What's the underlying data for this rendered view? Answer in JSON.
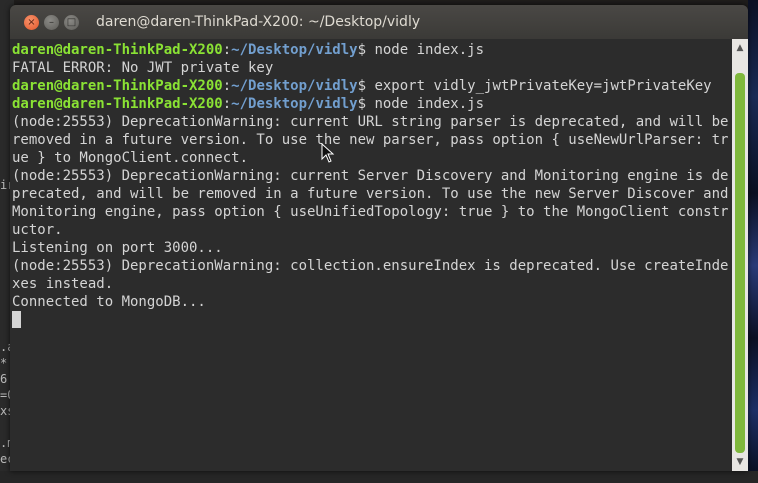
{
  "background": {
    "left_fragments": [
      "ir",
      ".a",
      "*",
      "6:",
      "=0",
      "xs",
      ".m",
      "ec"
    ]
  },
  "window": {
    "title": "daren@daren-ThinkPad-X200: ~/Desktop/vidly",
    "buttons": {
      "close": "×",
      "minimize": "–",
      "maximize": "□"
    }
  },
  "terminal": {
    "prompt_user": "daren@daren-ThinkPad-X200",
    "prompt_sep": ":",
    "prompt_path": "~/Desktop/vidly",
    "prompt_sym": "$ ",
    "cmd1": "node index.js",
    "out1": "FATAL ERROR: No JWT private key",
    "cmd2": "export vidly_jwtPrivateKey=jwtPrivateKey",
    "cmd3": "node index.js",
    "out2": "(node:25553) DeprecationWarning: current URL string parser is deprecated, and will be removed in a future version. To use the new parser, pass option { useNewUrlParser: true } to MongoClient.connect.",
    "out3": "(node:25553) DeprecationWarning: current Server Discovery and Monitoring engine is deprecated, and will be removed in a future version. To use the new Server Discover and Monitoring engine, pass option { useUnifiedTopology: true } to the MongoClient constructor.",
    "out4": "Listening on port 3000...",
    "out5": "(node:25553) DeprecationWarning: collection.ensureIndex is deprecated. Use createIndexes instead.",
    "out6": "Connected to MongoDB..."
  },
  "scrollbar": {
    "up": "▲",
    "down": "▼"
  },
  "colors": {
    "prompt_user": "#8ae234",
    "prompt_path": "#729fcf",
    "terminal_bg": "#2c2c2c",
    "text": "#d4d4d4",
    "scroll_thumb": "#7fb83c",
    "close_button": "#e2572a"
  }
}
